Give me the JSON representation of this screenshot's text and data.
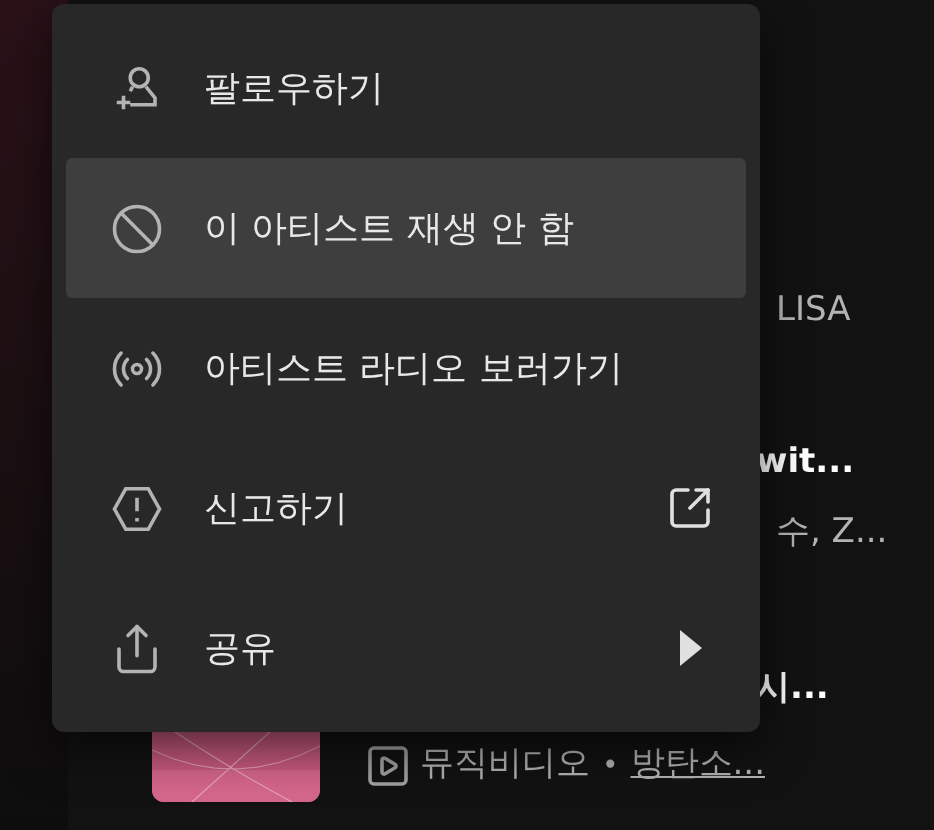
{
  "background_list": {
    "rows": [
      {
        "subtitle": "LISA"
      },
      {
        "title": "wit...",
        "subtitle": "수, Z..."
      },
      {
        "title": "시...",
        "kind": "music_video",
        "subtitle_label": "뮤직비디오",
        "separator": "•",
        "subtitle_link": "방탄소..."
      }
    ]
  },
  "context_menu": {
    "items": [
      {
        "kind": "follow",
        "label": "팔로우하기",
        "selected": false
      },
      {
        "kind": "block",
        "label": "이 아티스트 재생 안 함",
        "selected": true
      },
      {
        "kind": "radio",
        "label": "아티스트 라디오 보러가기",
        "selected": false
      },
      {
        "kind": "report",
        "label": "신고하기",
        "selected": false,
        "trailing": {
          "kind": "external"
        }
      },
      {
        "kind": "share",
        "label": "공유",
        "selected": false,
        "trailing": {
          "kind": "submenu"
        }
      }
    ]
  }
}
